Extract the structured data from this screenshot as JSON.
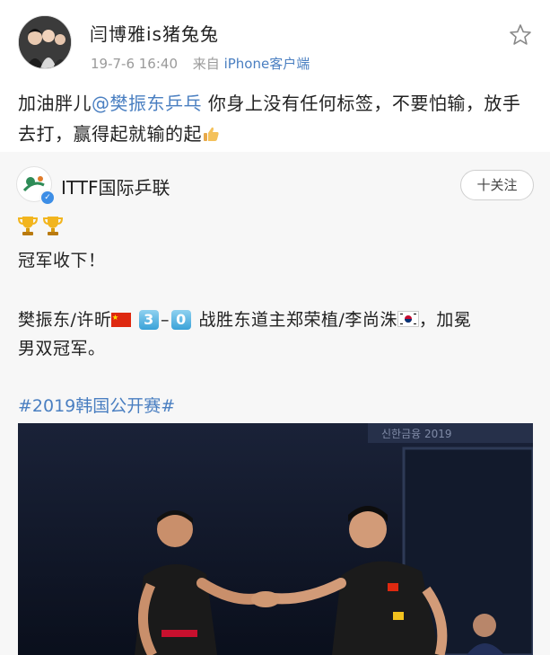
{
  "post": {
    "author": "闫博雅is猪兔兔",
    "time": "19-7-6 16:40",
    "source_prefix": "来自",
    "client": "iPhone客户端",
    "text_before_mention": "加油胖儿",
    "mention": "@樊振东乒乓",
    "text_after_mention": " 你身上没有任何标签，不要怕输，放手去打，赢得起就输的起"
  },
  "repost": {
    "account": "ITTF国际乒联",
    "follow_label": "十关注",
    "champion_text": "冠军收下！",
    "result_part1": "樊振东/许昕",
    "score_left": "3",
    "score_dash": "–",
    "score_right": "0",
    "result_part2": " 战胜东道主郑荣植/李尚洙",
    "result_part3": "，加冕",
    "result_line2": "男双冠军。",
    "hashtag": "#2019韩国公开赛#",
    "banner_text": "신한금융 2019"
  },
  "colors": {
    "link": "#4a7fc1",
    "text": "#222222",
    "muted": "#9a9a9a",
    "repost_bg": "#f7f7f7"
  },
  "icons": [
    "star-icon",
    "thumbs-up-icon",
    "trophy-icon",
    "verified-icon",
    "china-flag-icon",
    "korea-flag-icon"
  ]
}
